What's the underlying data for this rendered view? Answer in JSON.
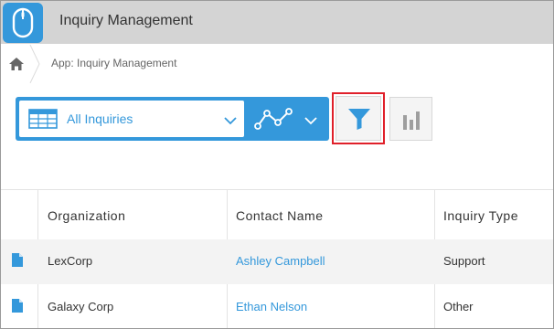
{
  "app": {
    "title": "Inquiry Management",
    "accent_color": "#3498db",
    "icon": "computer-mouse-icon"
  },
  "breadcrumb": {
    "home_icon": "home-icon",
    "label": "App: Inquiry Management"
  },
  "toolbar": {
    "view_selected": "All Inquiries",
    "view_icon": "table-view-icon",
    "graph_icon": "graph-icon",
    "filter_icon": "filter-funnel-icon",
    "chart_icon": "bar-chart-icon",
    "highlight_color": "#e0202a"
  },
  "table": {
    "columns": [
      "Organization",
      "Contact Name",
      "Inquiry Type"
    ],
    "rows": [
      {
        "organization": "LexCorp",
        "contact": "Ashley Campbell",
        "type": "Support"
      },
      {
        "organization": "Galaxy Corp",
        "contact": "Ethan Nelson",
        "type": "Other"
      }
    ]
  }
}
